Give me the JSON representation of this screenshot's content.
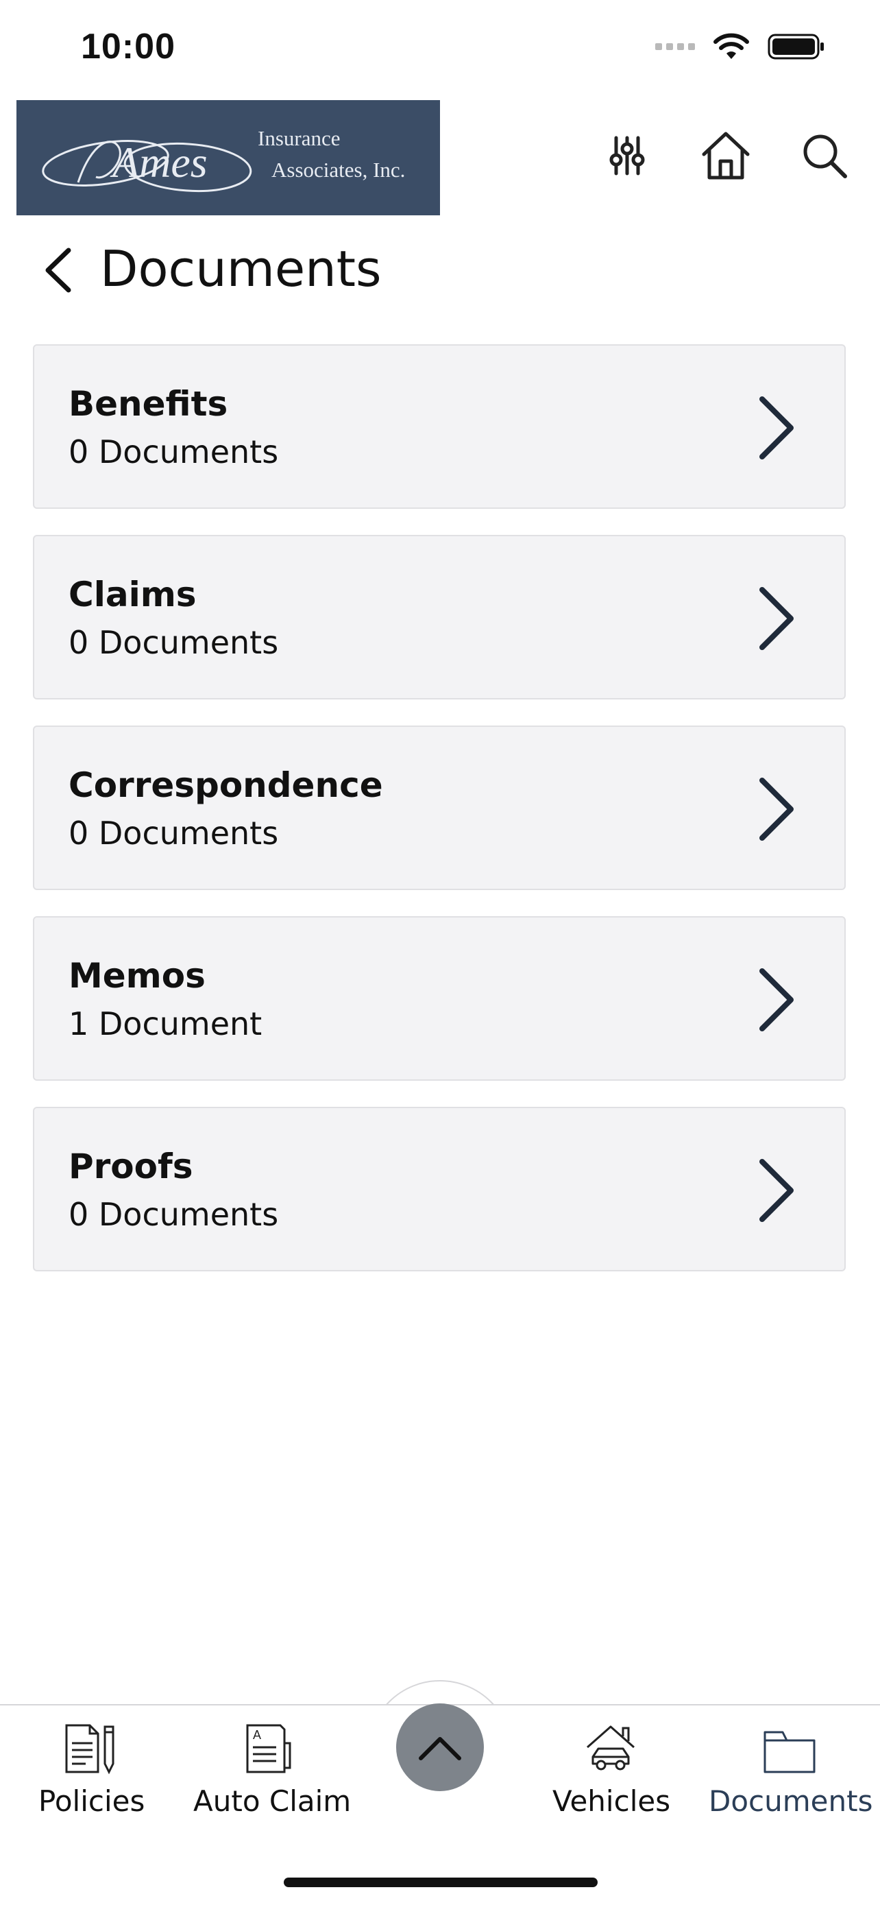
{
  "status_bar": {
    "time": "10:00"
  },
  "header": {
    "logo_line1": "Insurance",
    "logo_line2": "Associates, Inc.",
    "logo_script": "Ames",
    "actions": [
      "sliders-icon",
      "home-icon",
      "search-icon"
    ]
  },
  "page": {
    "title": "Documents"
  },
  "documents": [
    {
      "name": "Benefits",
      "count": "0 Documents"
    },
    {
      "name": "Claims",
      "count": "0 Documents"
    },
    {
      "name": "Correspondence",
      "count": "0 Documents"
    },
    {
      "name": "Memos",
      "count": "1 Document"
    },
    {
      "name": "Proofs",
      "count": "0 Documents"
    }
  ],
  "tabs": [
    {
      "label": "Policies",
      "icon": "policy-document-icon"
    },
    {
      "label": "Auto Claim",
      "icon": "auto-claim-icon"
    },
    {
      "label": "Vehicles",
      "icon": "vehicle-icon"
    },
    {
      "label": "Documents",
      "icon": "folder-icon",
      "active": true
    }
  ],
  "colors": {
    "brand": "#3b4d66",
    "card_bg": "#f3f3f5",
    "icon_dark": "#1f2a3a",
    "fab": "#7e848b"
  }
}
